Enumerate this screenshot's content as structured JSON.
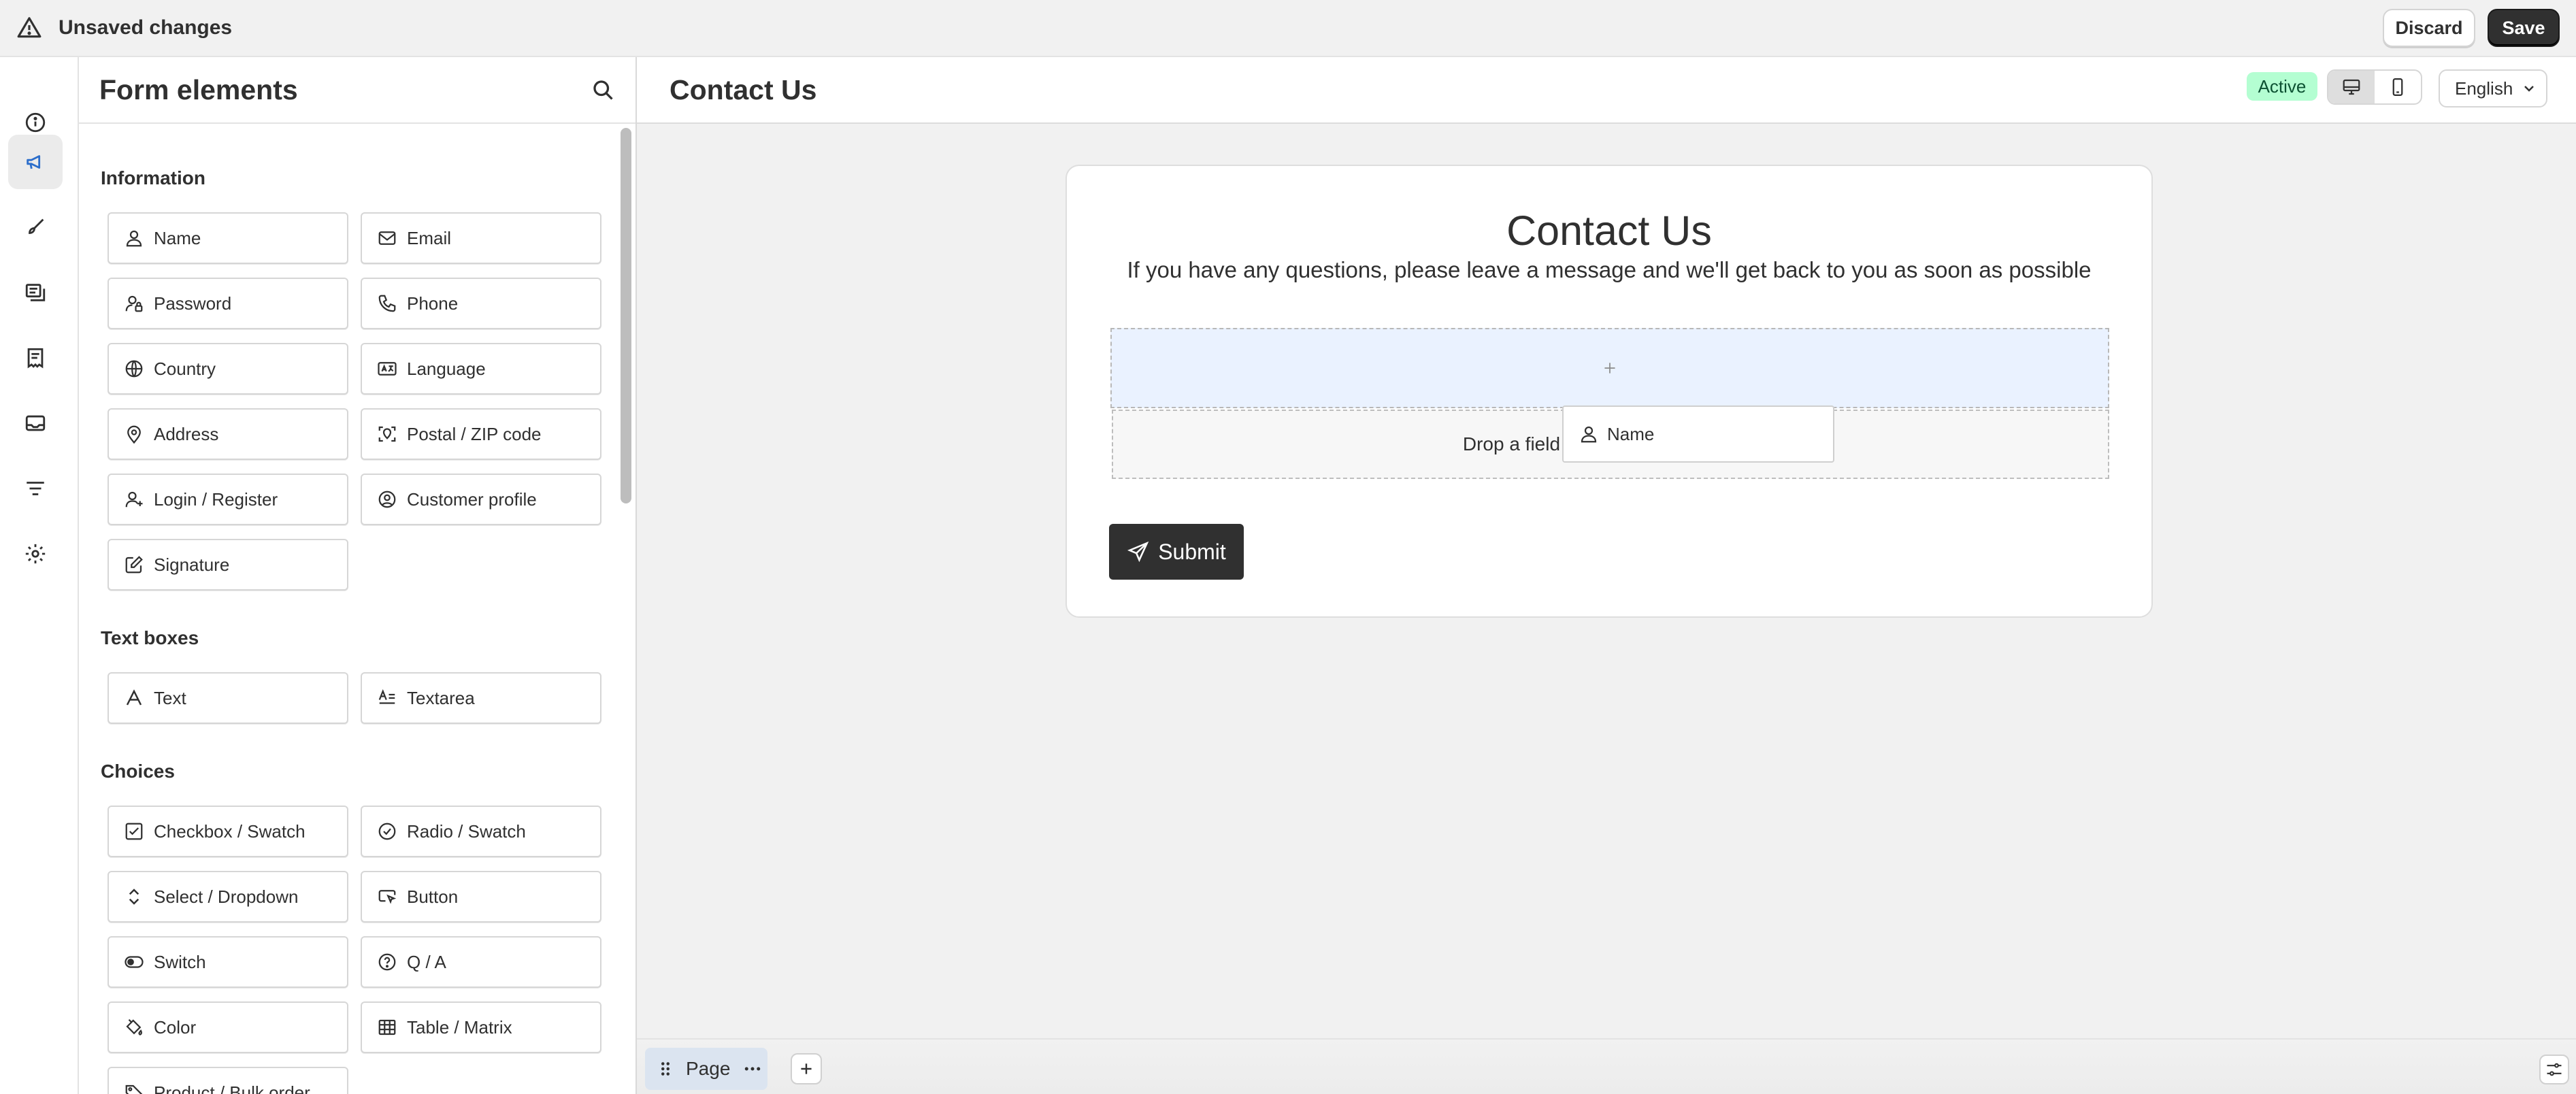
{
  "topbar": {
    "status": "Unsaved changes",
    "discard_label": "Discard",
    "save_label": "Save"
  },
  "rail": {
    "items": [
      "info-icon",
      "megaphone-icon",
      "brush-icon",
      "form-layers-icon",
      "receipt-icon",
      "mail-icon",
      "filter-icon",
      "gear-icon"
    ],
    "active_index": 1
  },
  "panel": {
    "title": "Form elements",
    "sections": [
      {
        "title": "Information",
        "items": [
          "Name",
          "Email",
          "Password",
          "Phone",
          "Country",
          "Language",
          "Address",
          "Postal / ZIP code",
          "Login / Register",
          "Customer profile",
          "Signature"
        ]
      },
      {
        "title": "Text boxes",
        "items": [
          "Text",
          "Textarea"
        ]
      },
      {
        "title": "Choices",
        "items": [
          "Checkbox / Swatch",
          "Radio / Swatch",
          "Select / Dropdown",
          "Button",
          "Switch",
          "Q / A",
          "Color",
          "Table / Matrix",
          "Product / Bulk order"
        ]
      }
    ]
  },
  "main": {
    "title": "Contact Us",
    "status_badge": "Active",
    "language": "English",
    "form": {
      "title": "Contact Us",
      "subtitle": "If you have any questions, please leave a message and we'll get back to you as soon as possible",
      "drop_hint": "Drop a field here to add a new row.",
      "submit_label": "Submit"
    },
    "drag_ghost_label": "Name"
  },
  "bottombar": {
    "page_tab": "Page"
  },
  "colors": {
    "accent_dark": "#303030",
    "active_badge_bg": "#b4fed2",
    "drop_active_bg": "#eaf2ff",
    "rail_active_icon": "#2c6ecb"
  }
}
